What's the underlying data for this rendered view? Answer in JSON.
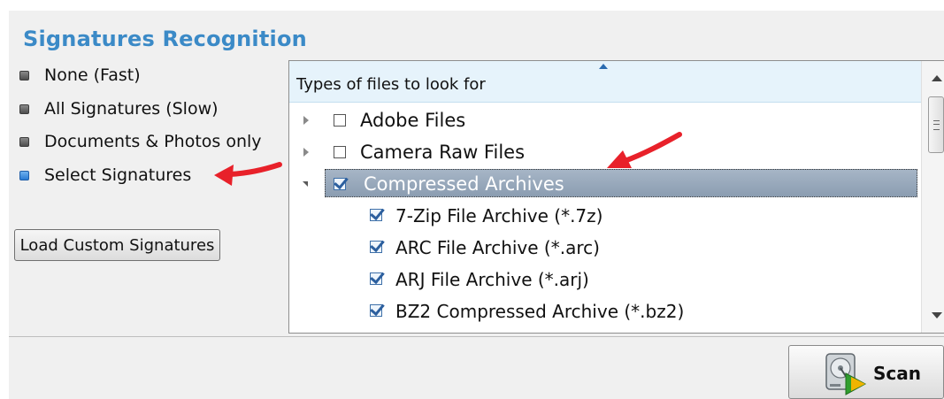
{
  "section_title": "Signatures Recognition",
  "signature_modes": [
    {
      "label": "None (Fast)",
      "selected": false
    },
    {
      "label": "All Signatures (Slow)",
      "selected": false
    },
    {
      "label": "Documents & Photos only",
      "selected": false
    },
    {
      "label": "Select Signatures",
      "selected": true
    }
  ],
  "load_button_label": "Load Custom Signatures",
  "tree": {
    "header_label": "Types of files to look for",
    "categories": [
      {
        "label": "Adobe Files",
        "checked": false,
        "expanded": false
      },
      {
        "label": "Camera Raw Files",
        "checked": false,
        "expanded": false
      },
      {
        "label": "Compressed Archives",
        "checked": true,
        "expanded": true,
        "selected": true
      }
    ],
    "children": [
      {
        "label": "7-Zip File Archive (*.7z)",
        "checked": true
      },
      {
        "label": "ARC File Archive (*.arc)",
        "checked": true
      },
      {
        "label": "ARJ File Archive (*.arj)",
        "checked": true
      },
      {
        "label": "BZ2 Compressed Archive (*.bz2)",
        "checked": true
      }
    ]
  },
  "scan_button_label": "Scan",
  "colors": {
    "title": "#3b8ac7",
    "selection": "#98a9bc",
    "annotation_arrow": "#e8212a"
  },
  "icons": [
    "expander-arrow-icon",
    "checkbox-icon",
    "scroll-up-icon",
    "scroll-down-icon",
    "hard-drive-scan-icon",
    "red-annotation-arrow-icon"
  ]
}
